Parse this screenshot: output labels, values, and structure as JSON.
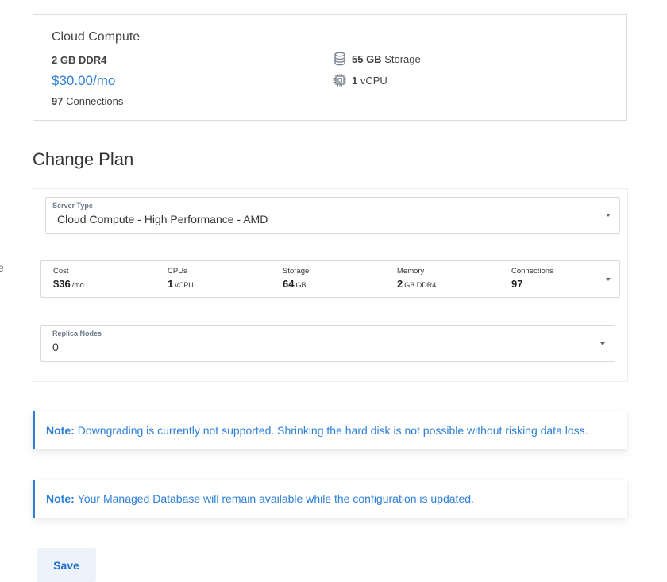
{
  "summary": {
    "plan_name": "Cloud Compute",
    "ram": "2 GB DDR4",
    "price": "$30.00/mo",
    "connections_value": "97",
    "connections_label": "Connections",
    "storage_value": "55 GB",
    "storage_label": "Storage",
    "vcpu_value": "1",
    "vcpu_label": "vCPU",
    "icons": {
      "storage": "database-icon",
      "cpu": "cpu-chip-icon"
    }
  },
  "change_plan": {
    "title": "Change Plan",
    "server_type": {
      "label": "Server Type",
      "value": "Cloud Compute - High Performance - AMD"
    },
    "plan_specs": [
      {
        "label": "Cost",
        "value": "$36",
        "unit": "/mo"
      },
      {
        "label": "CPUs",
        "value": "1",
        "unit": "vCPU"
      },
      {
        "label": "Storage",
        "value": "64",
        "unit": "GB"
      },
      {
        "label": "Memory",
        "value": "2",
        "unit": "GB DDR4"
      },
      {
        "label": "Connections",
        "value": "97",
        "unit": ""
      }
    ],
    "replica_nodes": {
      "label": "Replica Nodes",
      "value": "0"
    }
  },
  "notes": [
    {
      "label": "Note:",
      "text": "Downgrading is currently not supported. Shrinking the hard disk is not possible without risking data loss."
    },
    {
      "label": "Note:",
      "text": "Your Managed Database will remain available while the configuration is updated."
    }
  ],
  "save_label": "Save",
  "edge_glyph": "e",
  "colors": {
    "accent": "#2b7fd9",
    "button_bg": "#eef2fb",
    "border": "#d9d9d9"
  }
}
